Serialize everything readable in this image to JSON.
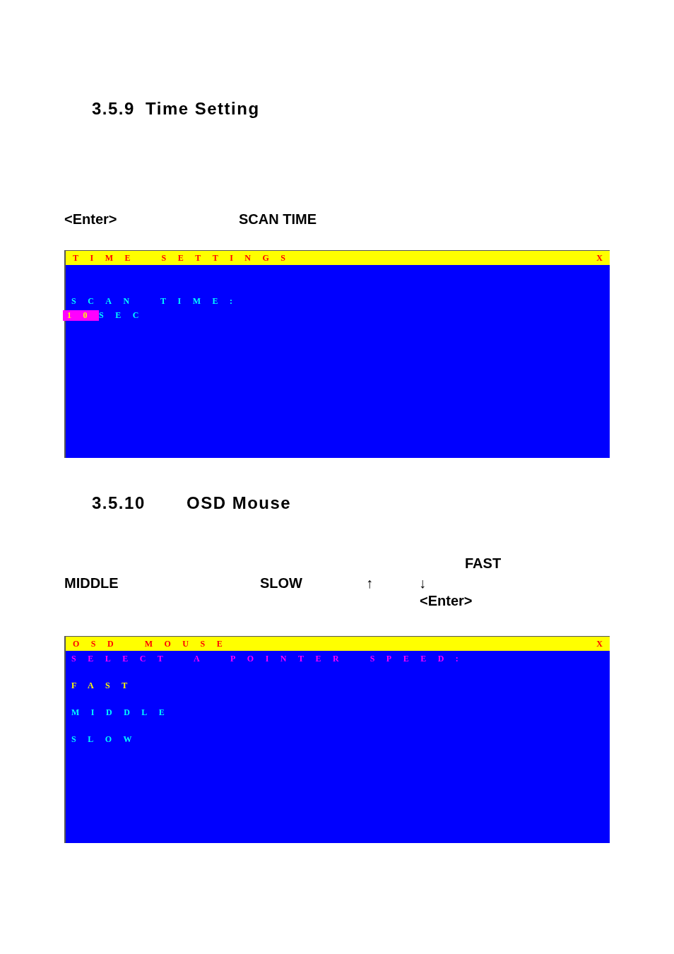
{
  "sections": [
    {
      "heading": {
        "number": "3.5.9",
        "title": "Time Setting"
      },
      "lines": [
        [
          "<Enter>",
          "SCAN TIME"
        ]
      ],
      "osd": {
        "title": "TIME SETTINGS",
        "close": "X",
        "rows": [
          {
            "kind": "prompt",
            "text": "SCAN TIME:"
          },
          {
            "kind": "value",
            "value": "10",
            "unit": "SEC",
            "selected": true
          }
        ]
      }
    },
    {
      "heading": {
        "number": "3.5.10",
        "title": "OSD Mouse"
      },
      "lines": [
        [
          "FAST"
        ],
        [
          "MIDDLE",
          "SLOW",
          "↑",
          "↓"
        ],
        [
          "<Enter>"
        ]
      ],
      "osd": {
        "title": "OSD MOUSE",
        "close": "X",
        "rows": [
          {
            "kind": "prompt",
            "text": "SELECT A POINTER SPEED:"
          },
          {
            "kind": "option",
            "text": "FAST",
            "selected": true
          },
          {
            "kind": "option",
            "text": "MIDDLE",
            "selected": false
          },
          {
            "kind": "option",
            "text": "SLOW",
            "selected": false
          }
        ]
      }
    }
  ]
}
